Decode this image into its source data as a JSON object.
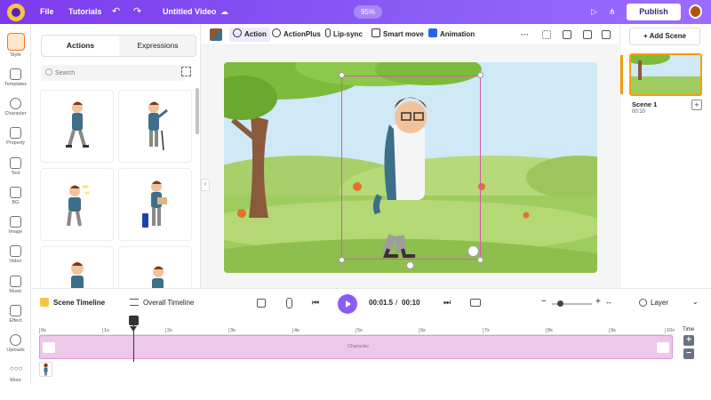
{
  "topbar": {
    "menu": [
      "File",
      "Tutorials"
    ],
    "title": "Untitled Video",
    "zoom": "95%",
    "publish": "Publish"
  },
  "leftnav": [
    {
      "label": "Style",
      "icon": "style-icon"
    },
    {
      "label": "Templates",
      "icon": "templates-icon"
    },
    {
      "label": "Character",
      "icon": "character-icon"
    },
    {
      "label": "Property",
      "icon": "property-icon"
    },
    {
      "label": "Text",
      "icon": "text-icon"
    },
    {
      "label": "BG",
      "icon": "bg-icon"
    },
    {
      "label": "Image",
      "icon": "image-icon"
    },
    {
      "label": "Video",
      "icon": "video-icon"
    },
    {
      "label": "Music",
      "icon": "music-icon"
    },
    {
      "label": "Effect",
      "icon": "effect-icon"
    },
    {
      "label": "Uploads",
      "icon": "uploads-icon"
    },
    {
      "label": "More",
      "icon": "more-icon"
    }
  ],
  "panel": {
    "tabs": [
      "Actions",
      "Expressions"
    ],
    "search_placeholder": "Search"
  },
  "toolbar": {
    "action": "Action",
    "actionplus": "ActionPlus",
    "lipsync": "Lip-sync",
    "smartmove": "Smart move",
    "animation": "Animation"
  },
  "scenes": {
    "add": "+ Add Scene",
    "scene_name": "Scene 1",
    "scene_time": "00:10"
  },
  "timeline": {
    "scene_timeline": "Scene Timeline",
    "overall_timeline": "Overall Timeline",
    "current": "00:01.5",
    "separator": "/",
    "total": "00:10",
    "layer": "Layer",
    "time_label": "Time",
    "track_label": "Character",
    "ticks": [
      "0s",
      "1s",
      "2s",
      "3s",
      "4s",
      "5s",
      "6s",
      "7s",
      "8s",
      "9s",
      "10s"
    ]
  },
  "colors": {
    "accent": "#8b5cf6",
    "scene_highlight": "#f59e0b",
    "track": "#edc8ea"
  }
}
